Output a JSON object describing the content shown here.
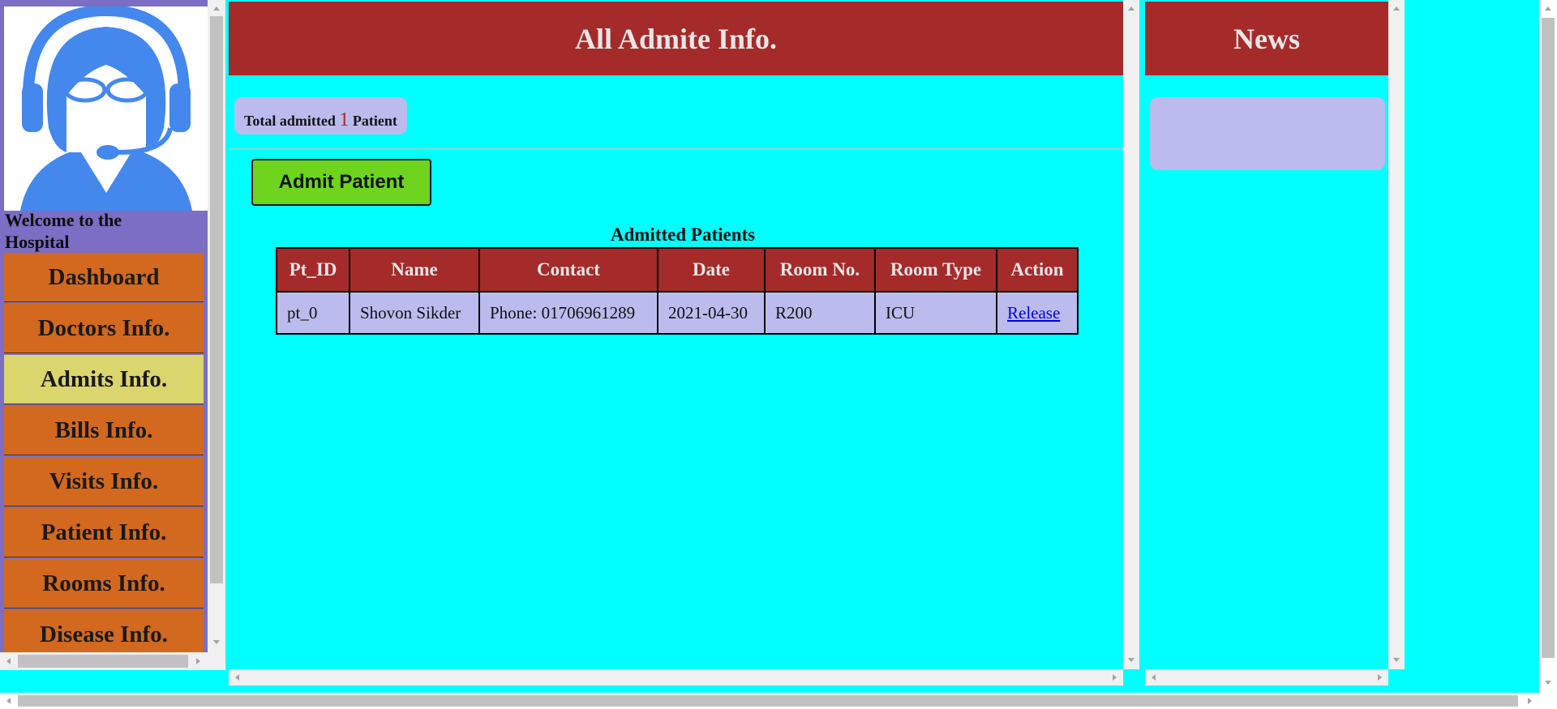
{
  "sidebar": {
    "welcome": "Welcome to the Hospital",
    "items": [
      {
        "label": "Dashboard",
        "active": false
      },
      {
        "label": "Doctors Info.",
        "active": false
      },
      {
        "label": "Admits Info.",
        "active": true
      },
      {
        "label": "Bills Info.",
        "active": false
      },
      {
        "label": "Visits Info.",
        "active": false
      },
      {
        "label": "Patient Info.",
        "active": false
      },
      {
        "label": "Rooms Info.",
        "active": false
      },
      {
        "label": "Disease Info.",
        "active": false
      }
    ]
  },
  "main": {
    "title": "All Admite Info.",
    "count_prefix": "Total admitted",
    "count_value": "1",
    "count_suffix": "Patient",
    "admit_button": "Admit Patient",
    "table_caption": "Admitted Patients",
    "columns": [
      "Pt_ID",
      "Name",
      "Contact",
      "Date",
      "Room No.",
      "Room Type",
      "Action"
    ],
    "rows": [
      {
        "pt_id": "pt_0",
        "name": "Shovon Sikder",
        "contact": "Phone: 01706961289",
        "date": "2021-04-30",
        "room_no": "R200",
        "room_type": "ICU",
        "action": "Release"
      }
    ]
  },
  "news": {
    "title": "News"
  },
  "colors": {
    "background": "#00ffff",
    "header": "#a52a2a",
    "nav": "#d2691e",
    "nav_active": "#dbd56e",
    "panel": "#bbbbee",
    "button": "#6ed41e"
  },
  "icons": {
    "avatar": "support-agent-icon"
  }
}
